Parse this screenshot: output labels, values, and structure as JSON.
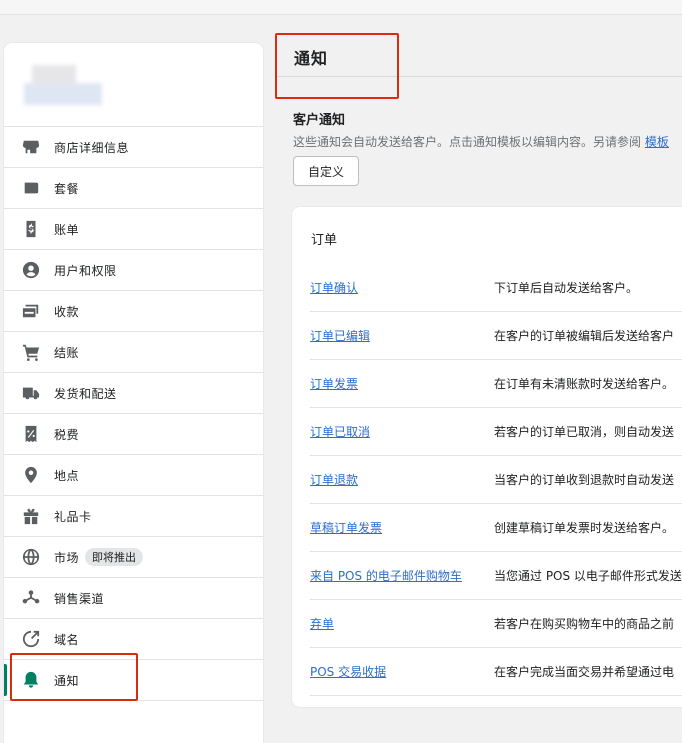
{
  "sidebar": {
    "items": [
      {
        "label": "商店详细信息",
        "icon": "store-icon"
      },
      {
        "label": "套餐",
        "icon": "plan-icon"
      },
      {
        "label": "账单",
        "icon": "billing-icon"
      },
      {
        "label": "用户和权限",
        "icon": "user-icon"
      },
      {
        "label": "收款",
        "icon": "payments-icon"
      },
      {
        "label": "结账",
        "icon": "cart-icon"
      },
      {
        "label": "发货和配送",
        "icon": "truck-icon"
      },
      {
        "label": "税费",
        "icon": "tax-icon"
      },
      {
        "label": "地点",
        "icon": "location-icon"
      },
      {
        "label": "礼品卡",
        "icon": "gift-icon"
      },
      {
        "label": "市场",
        "icon": "globe-icon",
        "badge": "即将推出"
      },
      {
        "label": "销售渠道",
        "icon": "channels-icon"
      },
      {
        "label": "域名",
        "icon": "domain-icon"
      },
      {
        "label": "通知",
        "icon": "bell-icon",
        "active": true
      }
    ]
  },
  "main": {
    "title": "通知",
    "section": {
      "title": "客户通知",
      "description": "这些通知会自动发送给客户。点击通知模板以编辑内容。另请参阅",
      "description_link": "模板",
      "customize_label": "自定义"
    },
    "card": {
      "title": "订单",
      "rows": [
        {
          "name": "订单确认",
          "desc": "下订单后自动发送给客户。"
        },
        {
          "name": "订单已编辑",
          "desc": "在客户的订单被编辑后发送给客户"
        },
        {
          "name": "订单发票",
          "desc": "在订单有未清账款时发送给客户。"
        },
        {
          "name": "订单已取消",
          "desc": "若客户的订单已取消，则自动发送"
        },
        {
          "name": "订单退款",
          "desc": "当客户的订单收到退款时自动发送"
        },
        {
          "name": "草稿订单发票",
          "desc": "创建草稿订单发票时发送给客户。"
        },
        {
          "name": "来自 POS 的电子邮件购物车",
          "desc": "当您通过 POS 以电子邮件形式发送"
        },
        {
          "name": "弃单",
          "desc": "若客户在购买购物车中的商品之前"
        },
        {
          "name": "POS 交易收据",
          "desc": "在客户完成当面交易并希望通过电"
        }
      ]
    }
  },
  "colors": {
    "accent": "#008060",
    "link": "#2c6ecb",
    "highlight": "#d82c0d"
  }
}
